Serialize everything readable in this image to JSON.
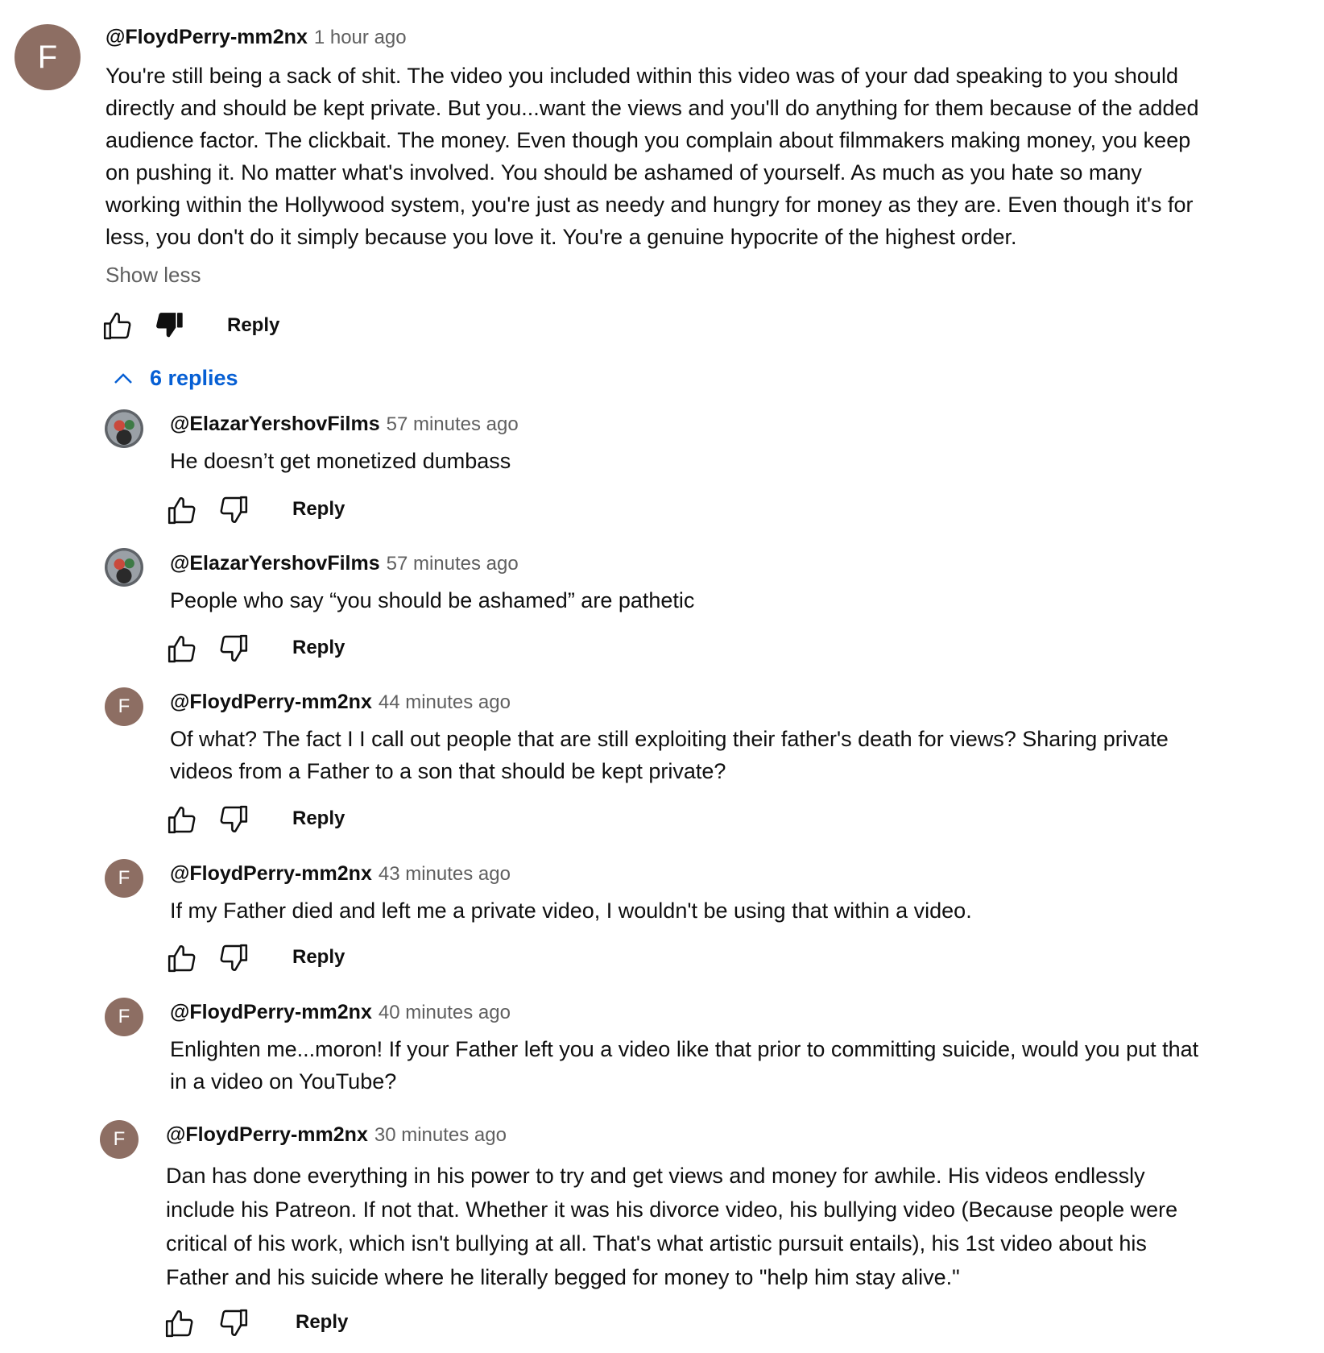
{
  "main_comment": {
    "avatar_letter": "F",
    "author": "@FloydPerry-mm2nx",
    "time": "1 hour ago",
    "lines": [
      "You're still being a sack of shit. The video you included within this video was of your dad speaking to you should",
      "directly and should be kept private. But you...want the views and you'll do anything for them because of the added",
      "audience factor. The clickbait. The money. Even though you complain about filmmakers making money, you keep",
      "on pushing it. No matter what's involved. You should be ashamed of yourself. As much as you hate so many",
      "working within the Hollywood system, you're just as needy and hungry for money as they are. Even though it's for",
      "less, you don't do it simply because you love it. You're a genuine hypocrite of the highest order."
    ],
    "show_less": "Show less",
    "reply_label": "Reply",
    "like_icon": "thumbs-up-outline-icon",
    "dislike_icon": "thumbs-down-filled-icon"
  },
  "replies_toggle": {
    "label": "6 replies",
    "icon": "chevron-up-icon"
  },
  "replies": [
    {
      "avatar_letter": "",
      "author": "@ElazarYershovFilms",
      "time": "57 minutes ago",
      "lines": [
        "He doesn’t get monetized dumbass"
      ],
      "reply_label": "Reply"
    },
    {
      "avatar_letter": "",
      "author": "@ElazarYershovFilms",
      "time": "57 minutes ago",
      "lines": [
        "People who say “you should be ashamed” are pathetic"
      ],
      "reply_label": "Reply"
    },
    {
      "avatar_letter": "F",
      "author": "@FloydPerry-mm2nx",
      "time": "44 minutes ago",
      "lines": [
        "Of what? The fact I I call out people that are still exploiting their father's death for views? Sharing private",
        "videos from a Father to a son that should be kept private?"
      ],
      "reply_label": "Reply"
    },
    {
      "avatar_letter": "F",
      "author": "@FloydPerry-mm2nx",
      "time": "43 minutes ago",
      "lines": [
        "If my Father died and left me a private video, I wouldn't be using that within a video."
      ],
      "reply_label": "Reply"
    },
    {
      "avatar_letter": "F",
      "author": "@FloydPerry-mm2nx",
      "time": "40 minutes ago",
      "lines": [
        "Enlighten me...moron! If your Father left you a video like that prior to committing suicide, would you put that",
        "in a video on YouTube?"
      ],
      "reply_label": "Reply"
    },
    {
      "avatar_letter": "F",
      "author": "@FloydPerry-mm2nx",
      "time": "30 minutes ago",
      "lines": [
        "Dan has done everything in his power to try and get views and money for awhile. His videos endlessly",
        "include his Patreon. If not that. Whether it was his divorce video, his bullying video (Because people were",
        "critical of his work, which isn't bullying at all. That's what artistic pursuit entails), his 1st video about his",
        "Father and his suicide where he literally begged for money to \"help him stay alive.\""
      ],
      "reply_label": "Reply"
    }
  ],
  "colors": {
    "avatar_bg": "#8d6e63",
    "link_blue": "#065fd4",
    "muted": "#606060"
  }
}
